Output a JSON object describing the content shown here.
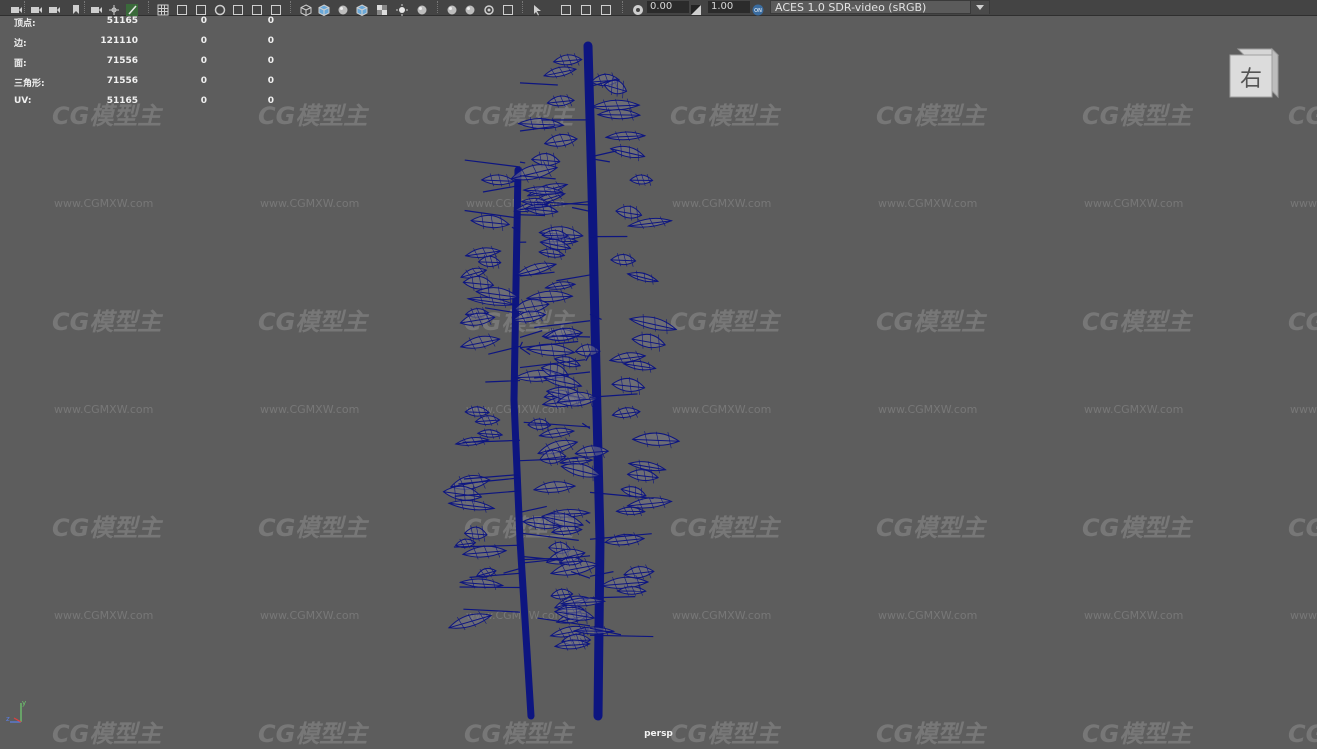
{
  "toolbar": {
    "exposure_value": "0.00",
    "gamma_value": "1.00",
    "color_space": "ACES 1.0 SDR-video (sRGB)",
    "icons": [
      "camera-icon",
      "camera-lock-icon",
      "camera-attrs-icon",
      "bookmark-icon",
      "image-plane-icon",
      "2d-pan-icon",
      "grease-pencil-icon",
      "grid-icon",
      "film-gate-icon",
      "resolution-gate-icon",
      "gate-mask-icon",
      "field-chart-icon",
      "safe-action-icon",
      "safe-title-icon",
      "wireframe-icon",
      "smooth-shade-icon",
      "default-material-icon",
      "shaded-wireframe-icon",
      "textured-icon",
      "use-lights-icon",
      "shadows-icon",
      "screen-space-ao-icon",
      "motion-blur-icon",
      "anti-aliasing-icon",
      "depth-of-field-icon",
      "isolate-select-icon",
      "xray-icon",
      "xray-joints-icon",
      "xray-active-icon",
      "backface-culling-icon",
      "exposure-icon",
      "gamma-icon",
      "color-management-icon"
    ]
  },
  "hud": {
    "rows": [
      {
        "label": "顶点:",
        "v1": "51165",
        "v2": "0",
        "v3": "0"
      },
      {
        "label": "边:",
        "v1": "121110",
        "v2": "0",
        "v3": "0"
      },
      {
        "label": "面:",
        "v1": "71556",
        "v2": "0",
        "v3": "0"
      },
      {
        "label": "三角形:",
        "v1": "71556",
        "v2": "0",
        "v3": "0"
      },
      {
        "label": "UV:",
        "v1": "51165",
        "v2": "0",
        "v3": "0"
      }
    ]
  },
  "viewcube": {
    "face_label": "右"
  },
  "viewport": {
    "camera": "persp"
  },
  "axis": {
    "y_label": "y",
    "z_label": "z",
    "x_color": "#e04040",
    "y_color": "#6fd06f",
    "z_color": "#5a7fe8"
  },
  "watermark": {
    "logo": "CG模型主",
    "url": "www.CGMXW.com"
  },
  "colors": {
    "wireframe": "#0d1580",
    "background": "#5d5d5d",
    "toolbar": "#444444"
  }
}
